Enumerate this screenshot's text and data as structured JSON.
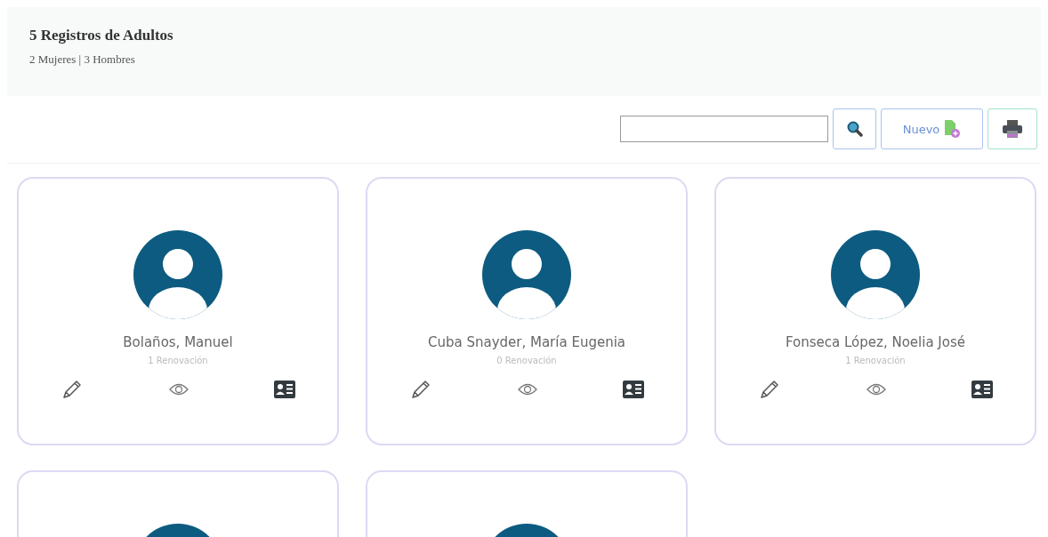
{
  "header": {
    "title": "5 Registros de Adultos",
    "subtitle": "2 Mujeres | 3 Hombres"
  },
  "toolbar": {
    "new_button": {
      "label": "Nuevo"
    }
  },
  "cards": [
    {
      "kind": "full",
      "name": "Bolaños, Manuel",
      "renewals": "1 Renovación"
    },
    {
      "kind": "full",
      "name": "Cuba Snayder, María Eugenia",
      "renewals": "0 Renovación"
    },
    {
      "kind": "full",
      "name": "Fonseca López, Noelia José",
      "renewals": "1 Renovación"
    },
    {
      "kind": "avatar"
    },
    {
      "kind": "avatar"
    }
  ]
}
